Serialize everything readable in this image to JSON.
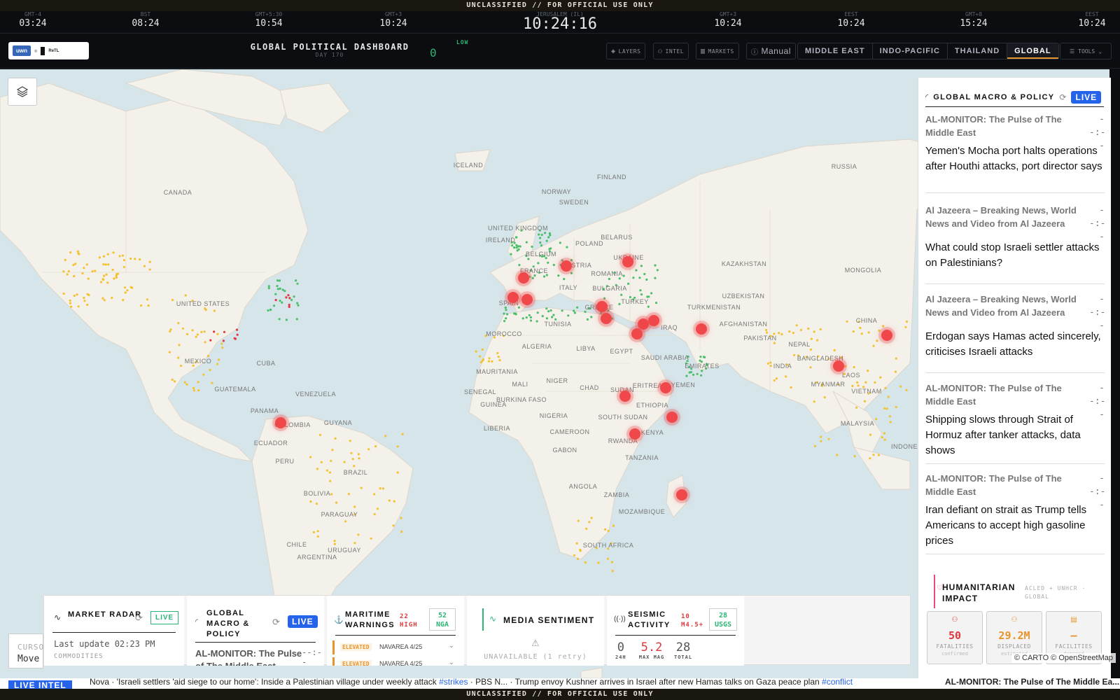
{
  "banner": {
    "top": "UNCLASSIFIED // FOR OFFICIAL USE ONLY",
    "bottom": "UNCLASSIFIED // FOR OFFICIAL USE ONLY"
  },
  "clocks": [
    {
      "tz": "GMT-4",
      "time": "03:24"
    },
    {
      "tz": "BST",
      "time": "08:24"
    },
    {
      "tz": "GMT+5:30",
      "time": "10:54"
    },
    {
      "tz": "GMT+3",
      "time": "10:24"
    },
    {
      "tz": "JERUSALEM (IL)",
      "time": "10:24:16"
    },
    {
      "tz": "GMT+3",
      "time": "10:24"
    },
    {
      "tz": "EEST",
      "time": "10:24"
    },
    {
      "tz": "GMT+8",
      "time": "15:24"
    },
    {
      "tz": "EEST",
      "time": "10:24"
    }
  ],
  "header": {
    "title": "GLOBAL POLITICAL DASHBOARD",
    "subtitle": "DAY 170",
    "threat_value": "0",
    "threat_level": "LOW",
    "buttons": {
      "layers": "LAYERS",
      "intel": "INTEL",
      "markets": "MARKETS",
      "manual": "Manual"
    },
    "regions": [
      "MIDDLE EAST",
      "INDO-PACIFIC",
      "THAILAND",
      "GLOBAL"
    ],
    "active_region": "GLOBAL",
    "tools": "TOOLS",
    "logo": {
      "a": "uwn",
      "b": "ReTL"
    }
  },
  "map": {
    "labels": {
      "canada": "CANADA",
      "us": "UNITED STATES",
      "mexico": "MEXICO",
      "cuba": "CUBA",
      "guatemala": "GUATEMALA",
      "panama": "PANAMA",
      "venezuela": "VENEZUELA",
      "guyana": "GUYANA",
      "colombia": "COLOMBIA",
      "ecuador": "ECUADOR",
      "peru": "PERU",
      "brazil": "BRAZIL",
      "bolivia": "BOLIVIA",
      "paraguay": "PARAGUAY",
      "chile": "CHILE",
      "uruguay": "URUGUAY",
      "argentina": "ARGENTINA",
      "iceland": "ICELAND",
      "norway": "NORWAY",
      "sweden": "SWEDEN",
      "finland": "FINLAND",
      "uk": "UNITED KINGDOM",
      "ireland": "IRELAND",
      "belgium": "BELGIUM",
      "poland": "POLAND",
      "belarus": "BELARUS",
      "ukraine": "UKRAINE",
      "france": "FRANCE",
      "austria": "AUSTRIA",
      "romania": "ROMANIA",
      "italy": "ITALY",
      "bulgaria": "BULGARIA",
      "spain": "SPAIN",
      "greece": "GREECE",
      "turkey": "TURKEY",
      "tunisia": "TUNISIA",
      "morocco": "MOROCCO",
      "algeria": "ALGERIA",
      "libya": "LIBYA",
      "egypt": "EGYPT",
      "iraq": "IRAQ",
      "saudi": "SAUDI ARABIA",
      "emirates": "EMIRATES",
      "yemen": "YEMEN",
      "eritrea": "ERITREA",
      "sudan": "SUDAN",
      "ssudan": "SOUTH SUDAN",
      "ethiopia": "ETHIOPIA",
      "kenya": "KENYA",
      "rwanda": "RWANDA",
      "tanzania": "TANZANIA",
      "mauritania": "MAURITANIA",
      "mali": "MALI",
      "niger": "NIGER",
      "chad": "CHAD",
      "senegal": "SENEGAL",
      "guinea": "GUINEA",
      "burkina": "BURKINA FASO",
      "nigeria": "NIGERIA",
      "liberia": "LIBERIA",
      "cameroon": "CAMEROON",
      "gabon": "GABON",
      "angola": "ANGOLA",
      "zambia": "ZAMBIA",
      "mozambique": "MOZAMBIQUE",
      "southafrica": "SOUTH AFRICA",
      "russia": "RUSSIA",
      "kazakhstan": "KAZAKHSTAN",
      "uzbekistan": "UZBEKISTAN",
      "turkmenistan": "TURKMENISTAN",
      "afghanistan": "AFGHANISTAN",
      "pakistan": "PAKISTAN",
      "india": "INDIA",
      "nepal": "NEPAL",
      "bangladesh": "BANGLADESH",
      "myanmar": "MYANMAR",
      "laos": "LAOS",
      "china": "CHINA",
      "mongolia": "MONGOLIA",
      "vietnam": "VIETNAM",
      "malaysia": "MALAYSIA",
      "indonesia": "INDONE"
    },
    "attribution": "© CARTO © OpenStreetMap"
  },
  "right_panel": {
    "title": "GLOBAL MACRO & POLICY",
    "live": "LIVE",
    "news": [
      {
        "source": "AL-MONITOR: The Pulse of The Middle East",
        "time": "--:--",
        "headline": "Yemen's Mocha port halts operations after Houthi attacks, port director says"
      },
      {
        "source": "Al Jazeera – Breaking News, World News and Video from Al Jazeera",
        "time": "--:--",
        "headline": "What could stop Israeli settler attacks on Palestinians?"
      },
      {
        "source": "Al Jazeera – Breaking News, World News and Video from Al Jazeera",
        "time": "--:--",
        "headline": "Erdogan says Hamas acted sincerely, criticises Israeli attacks"
      },
      {
        "source": "AL-MONITOR: The Pulse of The Middle East",
        "time": "--:--",
        "headline": "Shipping slows through Strait of Hormuz after tanker attacks, data shows"
      },
      {
        "source": "AL-MONITOR: The Pulse of The Middle East",
        "time": "--:--",
        "headline": "Iran defiant on strait as Trump tells Americans to accept high gasoline prices"
      }
    ],
    "humanitarian": {
      "title": "HUMANITARIAN IMPACT",
      "source": "ACLED + UNHCR · GLOBAL",
      "cards": [
        {
          "value": "50",
          "label": "FATALITIES",
          "sub": "confirmed",
          "color": "#e0393e"
        },
        {
          "value": "29.2M",
          "label": "DISPLACED",
          "sub": "estimated",
          "color": "#e8942c"
        },
        {
          "value": "—",
          "label": "FACILITIES",
          "sub": "damaged",
          "color": "#e8942c"
        }
      ]
    }
  },
  "bottom": {
    "market": {
      "title": "MARKET RADAR",
      "live": "LIVE",
      "update": "Last update 02:23 PM",
      "sub": "COMMODITIES"
    },
    "macro": {
      "title": "GLOBAL MACRO & POLICY",
      "live": "LIVE",
      "first": "AL-MONITOR: The Pulse of The Middle East",
      "time": "--:--"
    },
    "maritime": {
      "title": "MARITIME WARNINGS",
      "high": "22 HIGH",
      "badge": "52 NGA",
      "rows": [
        {
          "level": "ELEVATED",
          "area": "NAVAREA 4/25"
        },
        {
          "level": "ELEVATED",
          "area": "NAVAREA 4/25"
        }
      ]
    },
    "sentiment": {
      "title": "MEDIA SENTIMENT",
      "status": "UNAVAILABLE (1 retry)"
    },
    "seismic": {
      "title": "SEISMIC ACTIVITY",
      "count_label": "10 M4.5+",
      "badge": "28 USGS",
      "stats": [
        {
          "v": "0",
          "l": "24H"
        },
        {
          "v": "5.2",
          "l": "MAX MAG"
        },
        {
          "v": "28",
          "l": "TOTAL"
        }
      ]
    }
  },
  "cursor": {
    "label": "CURSO",
    "mode": "Move"
  },
  "ticker": {
    "label": "LIVE INTEL",
    "text": "Nova · 'Israeli settlers 'aid siege to our home': Inside a Palestinian village under weekly attack ",
    "tag1": "#strikes",
    "mid": " · PBS N... · Trump envoy Kushner arrives in Israel after new Hamas talks on Gaza peace plan ",
    "tag2": "#conflict",
    "right": "AL-MONITOR: The Pulse of The Middle Ea..."
  },
  "colors": {
    "accent": "#2563eb",
    "alert": "#f0474a",
    "active_region": "#e8942c",
    "threat_low": "#2bb673"
  }
}
